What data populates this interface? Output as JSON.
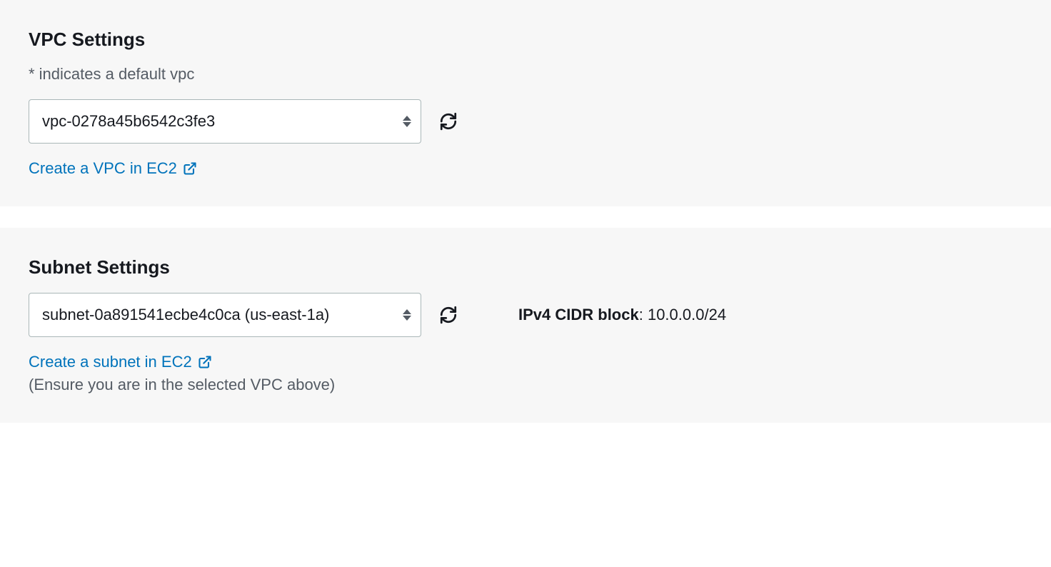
{
  "vpc": {
    "title": "VPC Settings",
    "hint": "* indicates a default vpc",
    "selected": "vpc-0278a45b6542c3fe3",
    "create_link": "Create a VPC in EC2"
  },
  "subnet": {
    "title": "Subnet Settings",
    "selected": "subnet-0a891541ecbe4c0ca (us-east-1a)",
    "create_link": "Create a subnet in EC2",
    "note": "(Ensure you are in the selected VPC above)",
    "cidr_label": "IPv4 CIDR block",
    "cidr_value": "10.0.0.0/24"
  }
}
